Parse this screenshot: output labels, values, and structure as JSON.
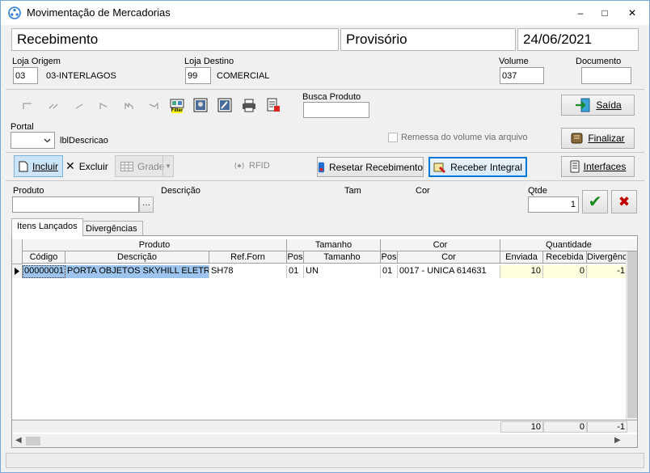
{
  "window": {
    "title": "Movimentação de Mercadorias",
    "controls": {
      "minimize": "–",
      "maximize": "□",
      "close": "✕"
    }
  },
  "header": {
    "type": "Recebimento",
    "status": "Provisório",
    "date": "24/06/2021"
  },
  "origin": {
    "label": "Loja Origem",
    "code": "03",
    "name": "03-INTERLAGOS"
  },
  "destination": {
    "label": "Loja Destino",
    "code": "99",
    "name": "COMERCIAL"
  },
  "volume": {
    "label": "Volume",
    "value": "037"
  },
  "documento": {
    "label": "Documento",
    "value": ""
  },
  "busca": {
    "label": "Busca Produto",
    "value": ""
  },
  "filter_icon_text": "Filter",
  "portal": {
    "label": "Portal",
    "value": "",
    "description": "lblDescricao"
  },
  "remessa": {
    "label": "Remessa do volume via arquivo",
    "checked": false
  },
  "buttons": {
    "saida": "Saída",
    "finalizar": "Finalizar",
    "incluir": "Incluir",
    "excluir": "Excluir",
    "grade": "Grade",
    "rfid": "RFID",
    "resetar": "Resetar Recebimento",
    "receber": "Receber Integral",
    "interfaces": "Interfaces"
  },
  "entry": {
    "produto_label": "Produto",
    "descricao_label": "Descrição",
    "tam_label": "Tam",
    "cor_label": "Cor",
    "qtde_label": "Qtde",
    "qtde_value": "1",
    "ellipsis": "···",
    "confirm_icon": "✔",
    "cancel_icon": "✖"
  },
  "tabs": [
    "Itens Lançados",
    "Divergências"
  ],
  "grid": {
    "groups": {
      "produto": "Produto",
      "tamanho": "Tamanho",
      "cor": "Cor",
      "quantidade": "Quantidade"
    },
    "columns": {
      "codigo": "Código",
      "descricao": "Descrição",
      "ref_forn": "Ref.Forn",
      "pos_tam": "Pos",
      "tamanho": "Tamanho",
      "pos_cor": "Pos",
      "cor": "Cor",
      "enviada": "Enviada",
      "recebida": "Recebida",
      "divergencia": "Divergênc"
    },
    "rows": [
      {
        "codigo": "00000001",
        "descricao": "PORTA OBJETOS SKYHILL ELETRON",
        "ref_forn": "SH78",
        "pos_tam": "01",
        "tamanho": "UN",
        "pos_cor": "01",
        "cor": "0017 - UNICA 614631",
        "enviada": "10",
        "recebida": "0",
        "divergencia": "-1"
      }
    ],
    "totals": {
      "enviada": "10",
      "recebida": "0",
      "divergencia": "-1"
    }
  },
  "colors": {
    "accent": "#0078d7",
    "highlight_cell": "#9cc4ec",
    "qty_cell": "#ffffe0",
    "confirm": "#1a8a1a",
    "cancel": "#c00000"
  }
}
